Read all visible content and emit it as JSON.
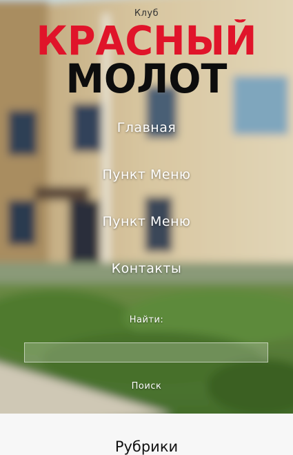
{
  "site": {
    "subtitle": "Клуб",
    "logo_line1": "КРАСНЫЙ",
    "logo_line2": "МОЛОТ",
    "colors": {
      "logo_red": "#e0142a",
      "logo_black": "#0d0d0d"
    }
  },
  "nav": {
    "items": [
      {
        "label": "Главная"
      },
      {
        "label": "Пункт Меню"
      },
      {
        "label": "Пункт Меню"
      },
      {
        "label": "Контакты"
      }
    ]
  },
  "search": {
    "label": "Найти:",
    "value": "",
    "button_label": "Поиск"
  },
  "sidebar": {
    "rubrics_title": "Рубрики"
  }
}
